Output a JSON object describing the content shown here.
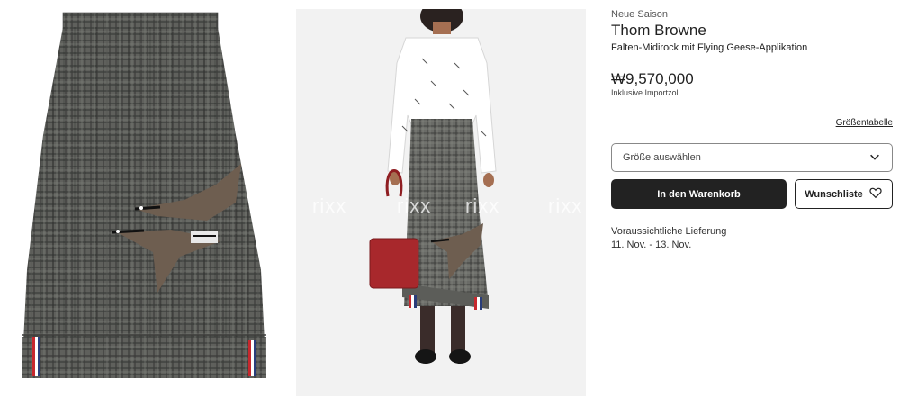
{
  "product": {
    "label": "Neue Saison",
    "brand": "Thom Browne",
    "description": "Falten-Midirock mit Flying Geese-Applikation",
    "price": "₩9,570,000",
    "price_note": "Inklusive Importzoll"
  },
  "size": {
    "guide_link": "Größentabelle",
    "select_placeholder": "Größe auswählen",
    "icon": "chevron-down-icon"
  },
  "actions": {
    "add_to_cart": "In den Warenkorb",
    "wishlist": "Wunschliste",
    "wishlist_icon": "heart-icon"
  },
  "delivery": {
    "label": "Voraussichtliche Lieferung",
    "dates": "11. Nov. - 13. Nov."
  },
  "images": {
    "watermark": "rixx"
  }
}
